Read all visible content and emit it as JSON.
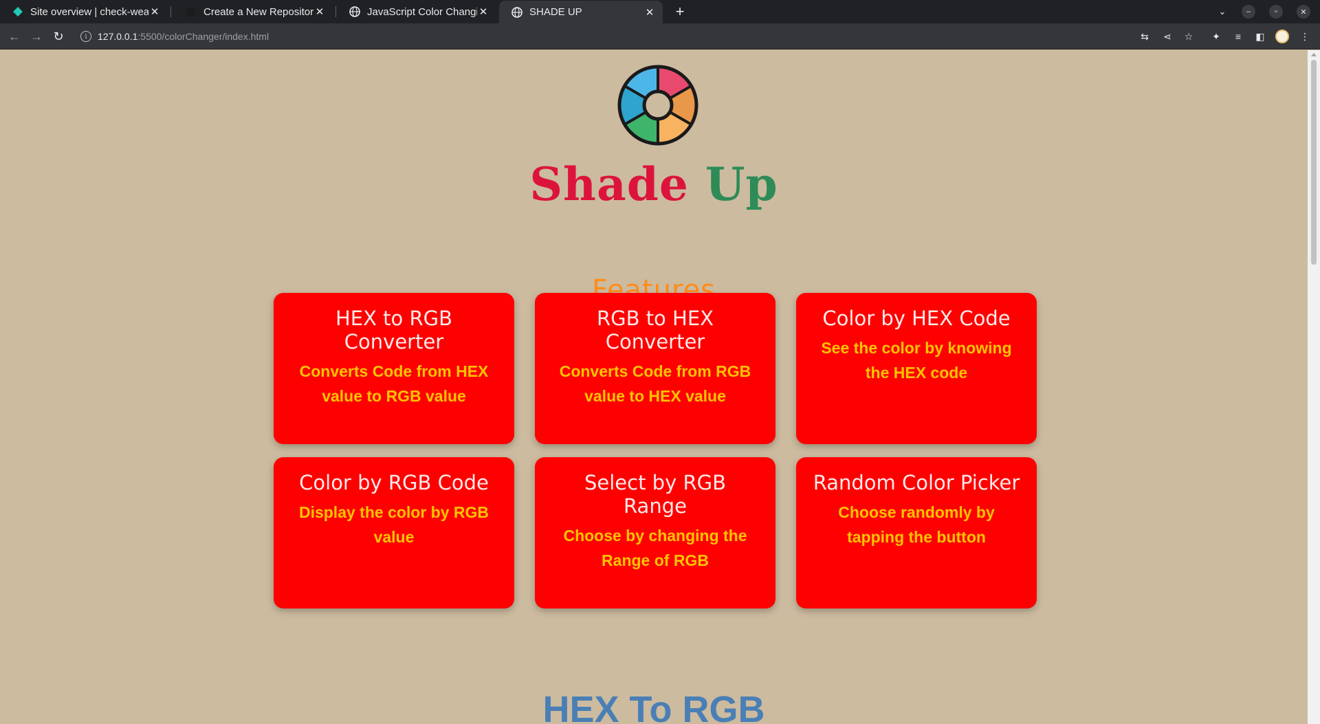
{
  "browser": {
    "tabs": [
      {
        "title": "Site overview | check-wea",
        "icon": "netlify-icon"
      },
      {
        "title": "Create a New Repository",
        "icon": "github-icon"
      },
      {
        "title": "JavaScript Color Changin",
        "icon": "globe-icon"
      },
      {
        "title": "SHADE UP",
        "icon": "globe-icon",
        "active": true
      }
    ],
    "url_host": "127.0.0.1",
    "url_rest": ":5500/colorChanger/index.html"
  },
  "site": {
    "title_word1": "Shade",
    "title_word2": "Up",
    "features_heading": "Features",
    "title_color1": "#dc143c",
    "title_color2": "#2e8b57",
    "accent": "#ff8c1a",
    "card_color": "#ff0000",
    "background": "#ccbb9f"
  },
  "cards": [
    {
      "title": "HEX to RGB Converter",
      "desc": "Converts Code from HEX value to RGB value"
    },
    {
      "title": "RGB to HEX Converter",
      "desc": "Converts Code from RGB value to HEX value"
    },
    {
      "title": "Color by HEX Code",
      "desc": "See the color by knowing the HEX code"
    },
    {
      "title": "Color by RGB Code",
      "desc": "Display the color by RGB value"
    },
    {
      "title": "Select by RGB Range",
      "desc": "Choose by changing the Range of RGB"
    },
    {
      "title": "Random Color Picker",
      "desc": "Choose randomly by tapping the button"
    }
  ],
  "section_heading": "HEX To RGB"
}
